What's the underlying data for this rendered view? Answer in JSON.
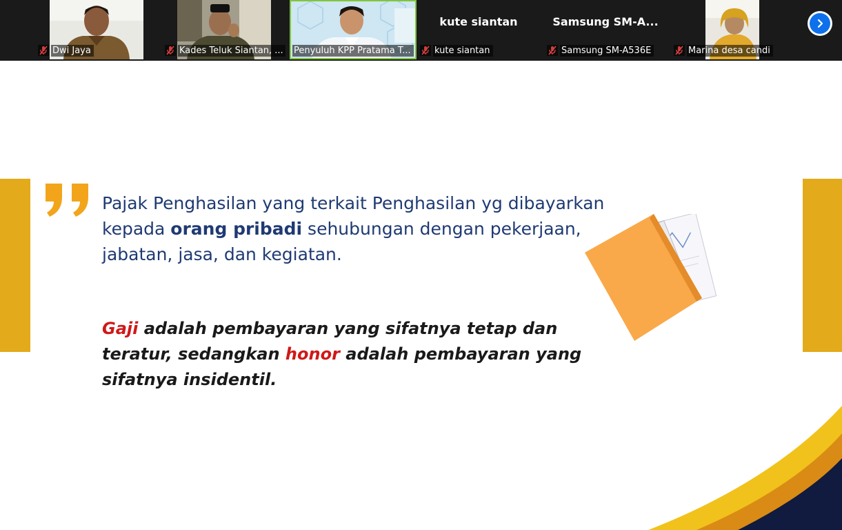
{
  "participants": [
    {
      "name": "Dwi Jaya",
      "muted": true,
      "video": true
    },
    {
      "name": "Kades Teluk Siantan, ...",
      "muted": true,
      "video": true
    },
    {
      "name": "Penyuluh KPP Pratama T...",
      "muted": false,
      "video": true,
      "active": true
    },
    {
      "name": "kute siantan",
      "display_name": "kute siantan",
      "muted": true,
      "video": false
    },
    {
      "name": "Samsung SM-A536E",
      "display_name": "Samsung  SM-A...",
      "muted": true,
      "video": false
    },
    {
      "name": "Marina desa candi",
      "muted": true,
      "video": true
    }
  ],
  "icons": {
    "mute": "microphone-muted-icon",
    "next": "chevron-right-icon"
  },
  "slide": {
    "para1": {
      "part1": "Pajak Penghasilan yang terkait Penghasilan yg dibayarkan kepada ",
      "bold": "orang pribadi",
      "part2": " sehubungan dengan pekerjaan, jabatan, jasa, dan kegiatan."
    },
    "para2": {
      "red1": "Gaji",
      "text1": " adalah pembayaran yang sifatnya tetap dan teratur, sedangkan ",
      "red2": "honor",
      "text2": " adalah pembayaran yang sifatnya insidentil."
    }
  },
  "colors": {
    "accent_yellow": "#e3ab1b",
    "text_blue": "#1f3a73",
    "text_red": "#d01818",
    "active_border": "#7ec73a",
    "zoom_blue": "#0e71eb",
    "navy": "#111a3f"
  }
}
